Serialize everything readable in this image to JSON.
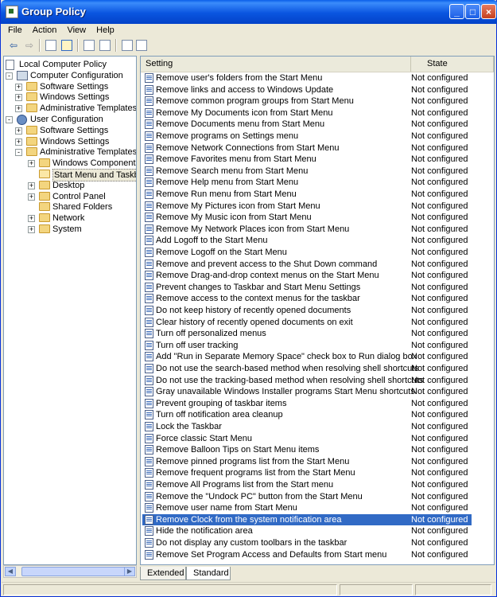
{
  "window": {
    "title": "Group Policy"
  },
  "menu": [
    "File",
    "Action",
    "View",
    "Help"
  ],
  "toolbar": [
    "back-icon",
    "forward-icon",
    "up-folder-icon",
    "show-hide-tree-icon",
    "properties-icon",
    "export-list-icon",
    "help-icon",
    "view-icon"
  ],
  "tree": [
    {
      "label": "Local Computer Policy",
      "level": 0,
      "icon": "policy-doc-icon"
    },
    {
      "label": "Computer Configuration",
      "level": 1,
      "icon": "computer-icon",
      "expander": "-"
    },
    {
      "label": "Software Settings",
      "level": 2,
      "icon": "folder-icon",
      "expander": "+"
    },
    {
      "label": "Windows Settings",
      "level": 2,
      "icon": "folder-icon",
      "expander": "+"
    },
    {
      "label": "Administrative Templates",
      "level": 2,
      "icon": "folder-icon",
      "expander": "+"
    },
    {
      "label": "User Configuration",
      "level": 1,
      "icon": "user-icon",
      "expander": "-"
    },
    {
      "label": "Software Settings",
      "level": 2,
      "icon": "folder-icon",
      "expander": "+"
    },
    {
      "label": "Windows Settings",
      "level": 2,
      "icon": "folder-icon",
      "expander": "+"
    },
    {
      "label": "Administrative Templates",
      "level": 2,
      "icon": "folder-icon",
      "expander": "-"
    },
    {
      "label": "Windows Components",
      "level": 3,
      "icon": "folder-icon",
      "expander": "+"
    },
    {
      "label": "Start Menu and Taskbar",
      "level": 3,
      "icon": "folder-open-icon",
      "selected": true
    },
    {
      "label": "Desktop",
      "level": 3,
      "icon": "folder-icon",
      "expander": "+"
    },
    {
      "label": "Control Panel",
      "level": 3,
      "icon": "folder-icon",
      "expander": "+"
    },
    {
      "label": "Shared Folders",
      "level": 3,
      "icon": "folder-icon"
    },
    {
      "label": "Network",
      "level": 3,
      "icon": "folder-icon",
      "expander": "+"
    },
    {
      "label": "System",
      "level": 3,
      "icon": "folder-icon",
      "expander": "+"
    }
  ],
  "columns": {
    "setting": "Setting",
    "state": "State"
  },
  "rows": [
    {
      "setting": "Remove user's folders from the Start Menu",
      "state": "Not configured"
    },
    {
      "setting": "Remove links and access to Windows Update",
      "state": "Not configured"
    },
    {
      "setting": "Remove common program groups from Start Menu",
      "state": "Not configured"
    },
    {
      "setting": "Remove My Documents icon from Start Menu",
      "state": "Not configured"
    },
    {
      "setting": "Remove Documents menu from Start Menu",
      "state": "Not configured"
    },
    {
      "setting": "Remove programs on Settings menu",
      "state": "Not configured"
    },
    {
      "setting": "Remove Network Connections from Start Menu",
      "state": "Not configured"
    },
    {
      "setting": "Remove Favorites menu from Start Menu",
      "state": "Not configured"
    },
    {
      "setting": "Remove Search menu from Start Menu",
      "state": "Not configured"
    },
    {
      "setting": "Remove Help menu from Start Menu",
      "state": "Not configured"
    },
    {
      "setting": "Remove Run menu from Start Menu",
      "state": "Not configured"
    },
    {
      "setting": "Remove My Pictures icon from Start Menu",
      "state": "Not configured"
    },
    {
      "setting": "Remove My Music icon from Start Menu",
      "state": "Not configured"
    },
    {
      "setting": "Remove My Network Places icon from Start Menu",
      "state": "Not configured"
    },
    {
      "setting": "Add Logoff to the Start Menu",
      "state": "Not configured"
    },
    {
      "setting": "Remove Logoff on the Start Menu",
      "state": "Not configured"
    },
    {
      "setting": "Remove and prevent access to the Shut Down command",
      "state": "Not configured"
    },
    {
      "setting": "Remove Drag-and-drop context menus on the Start Menu",
      "state": "Not configured"
    },
    {
      "setting": "Prevent changes to Taskbar and Start Menu Settings",
      "state": "Not configured"
    },
    {
      "setting": "Remove access to the context menus for the taskbar",
      "state": "Not configured"
    },
    {
      "setting": "Do not keep history of recently opened documents",
      "state": "Not configured"
    },
    {
      "setting": "Clear history of recently opened documents on exit",
      "state": "Not configured"
    },
    {
      "setting": "Turn off personalized menus",
      "state": "Not configured"
    },
    {
      "setting": "Turn off user tracking",
      "state": "Not configured"
    },
    {
      "setting": "Add \"Run in Separate Memory Space\" check box to Run dialog box",
      "state": "Not configured"
    },
    {
      "setting": "Do not use the search-based method when resolving shell shortcuts",
      "state": "Not configured"
    },
    {
      "setting": "Do not use the tracking-based method when resolving shell shortcuts",
      "state": "Not configured"
    },
    {
      "setting": "Gray unavailable Windows Installer programs Start Menu shortcuts",
      "state": "Not configured"
    },
    {
      "setting": "Prevent grouping of taskbar items",
      "state": "Not configured"
    },
    {
      "setting": "Turn off notification area cleanup",
      "state": "Not configured"
    },
    {
      "setting": "Lock the Taskbar",
      "state": "Not configured"
    },
    {
      "setting": "Force classic Start Menu",
      "state": "Not configured"
    },
    {
      "setting": "Remove Balloon Tips on Start Menu items",
      "state": "Not configured"
    },
    {
      "setting": "Remove pinned programs list from the Start Menu",
      "state": "Not configured"
    },
    {
      "setting": "Remove frequent programs list from the Start Menu",
      "state": "Not configured"
    },
    {
      "setting": "Remove All Programs list from the Start menu",
      "state": "Not configured"
    },
    {
      "setting": "Remove the \"Undock PC\" button from the Start Menu",
      "state": "Not configured"
    },
    {
      "setting": "Remove user name from Start Menu",
      "state": "Not configured"
    },
    {
      "setting": "Remove Clock from the system notification area",
      "state": "Not configured",
      "selected": true
    },
    {
      "setting": "Hide the notification area",
      "state": "Not configured"
    },
    {
      "setting": "Do not display any custom toolbars in the taskbar",
      "state": "Not configured"
    },
    {
      "setting": "Remove Set Program Access and Defaults from Start menu",
      "state": "Not configured"
    }
  ],
  "tabs": [
    "Extended",
    "Standard"
  ],
  "active_tab": "Standard"
}
